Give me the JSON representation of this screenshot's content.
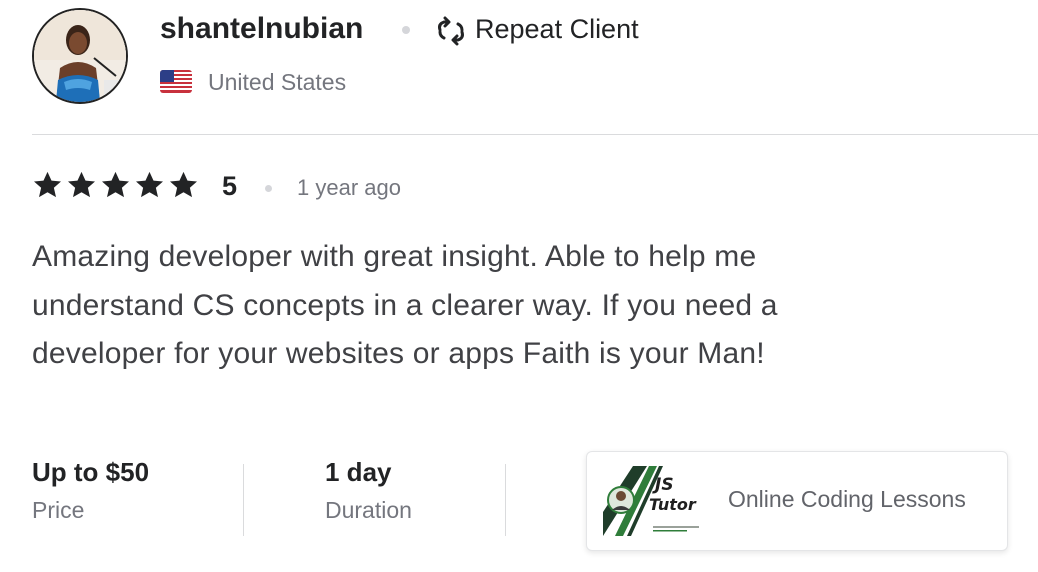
{
  "reviewer": {
    "username": "shantelnubian",
    "badge_label": "Repeat Client",
    "badge_icon": "repeat-icon",
    "country": "United States",
    "flag_icon": "us-flag-icon"
  },
  "review": {
    "stars": 5,
    "rating_value": "5",
    "time_ago": "1 year ago",
    "text": "Amazing developer with great insight. Able to help me understand CS concepts in a clearer way. If you need a developer for your websites or apps Faith is your Man!"
  },
  "stats": {
    "price_value": "Up to $50",
    "price_label": "Price",
    "duration_value": "1 day",
    "duration_label": "Duration"
  },
  "gig": {
    "title": "Online Coding Lessons",
    "thumbnail_text_line1": "JS",
    "thumbnail_text_line2": "Tutor"
  },
  "colors": {
    "text_dark": "#222325",
    "text_muted": "#74767e",
    "body_text": "#404145",
    "divider": "#dadbdd",
    "star": "#222325"
  }
}
